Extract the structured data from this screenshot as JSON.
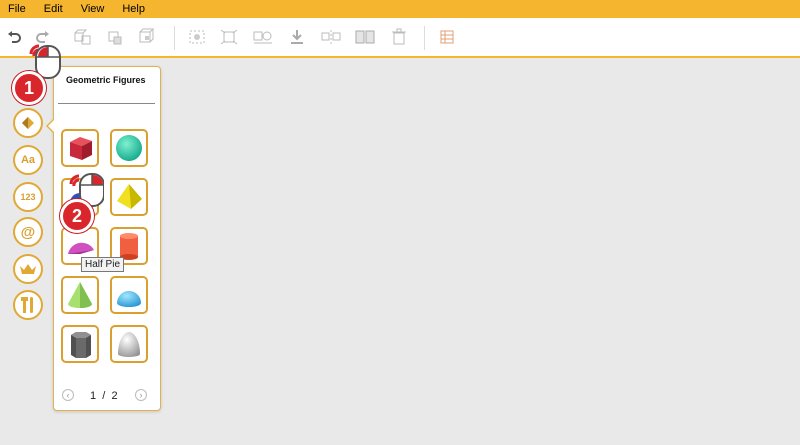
{
  "menu": [
    "File",
    "Edit",
    "View",
    "Help"
  ],
  "panel": {
    "title": "Geometric Figures",
    "page_current": "1",
    "page_sep": "/",
    "page_total": "2",
    "tooltip": "Half Pie"
  },
  "markers": [
    "1",
    "2"
  ],
  "sidebar": {
    "text_label": "Aa",
    "number_label": "123",
    "at_label": "@"
  },
  "colors": {
    "accent": "#f6b52e",
    "border": "#d9a030",
    "marker": "#d8262c"
  }
}
